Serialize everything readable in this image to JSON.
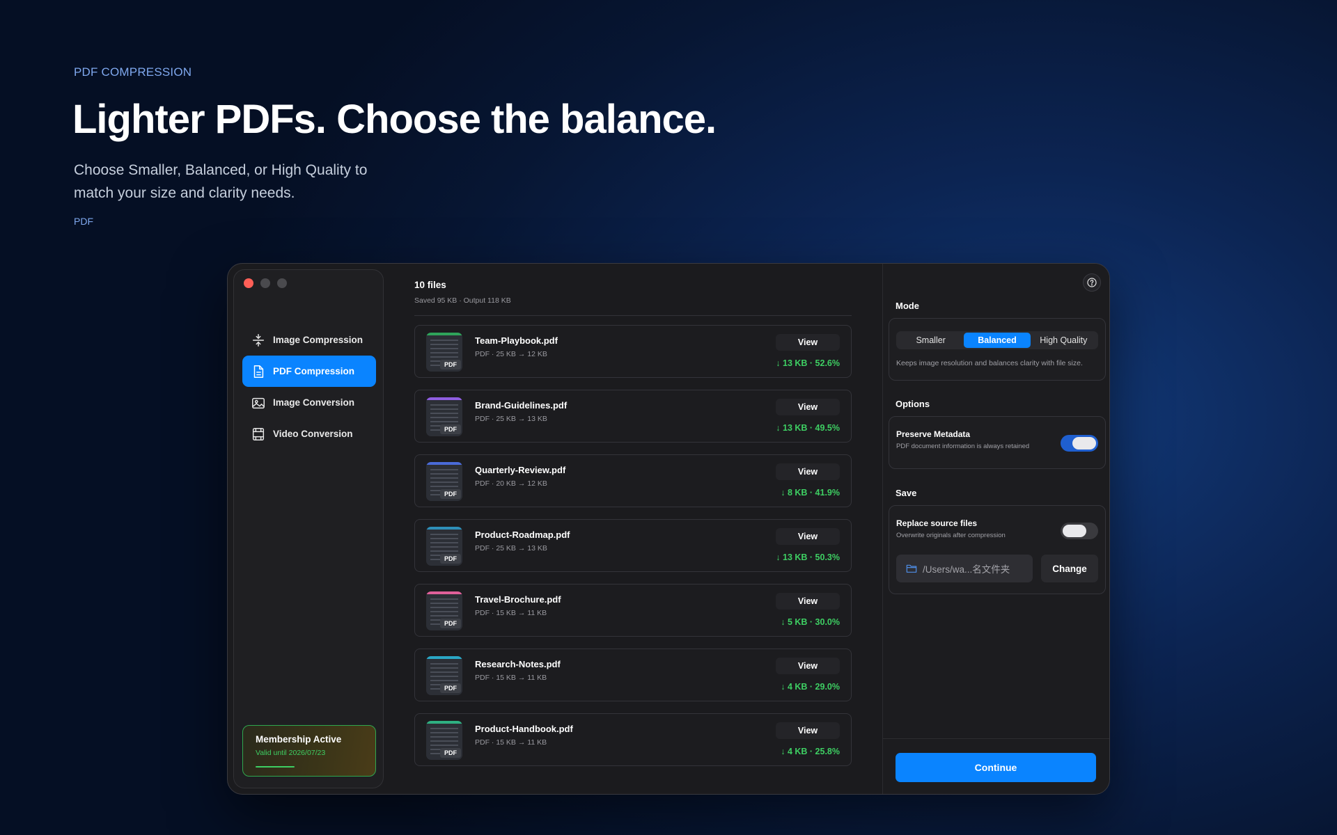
{
  "hero": {
    "eyebrow": "PDF COMPRESSION",
    "title": "Lighter PDFs. Choose the balance.",
    "subtitle": "Choose Smaller, Balanced, or High Quality to match your size and clarity needs.",
    "tag": "PDF"
  },
  "sidebar": {
    "items": [
      {
        "label": "Image Compression",
        "icon": "compress-icon"
      },
      {
        "label": "PDF Compression",
        "icon": "document-icon",
        "active": true
      },
      {
        "label": "Image Conversion",
        "icon": "image-icon"
      },
      {
        "label": "Video Conversion",
        "icon": "film-icon"
      }
    ],
    "membership": {
      "title": "Membership Active",
      "valid": "Valid until 2026/07/23"
    }
  },
  "main": {
    "title": "10 files",
    "subtitle": "Saved 95 KB · Output 118 KB",
    "view_label": "View",
    "files": [
      {
        "name": "Team-Playbook.pdf",
        "meta": "PDF · 25 KB → 12 KB",
        "saved": "↓ 13 KB · 52.6%",
        "color": "#2fa35a"
      },
      {
        "name": "Brand-Guidelines.pdf",
        "meta": "PDF · 25 KB → 13 KB",
        "saved": "↓ 13 KB · 49.5%",
        "color": "#8f5ee0"
      },
      {
        "name": "Quarterly-Review.pdf",
        "meta": "PDF · 20 KB → 12 KB",
        "saved": "↓ 8 KB · 41.9%",
        "color": "#4a6bd8"
      },
      {
        "name": "Product-Roadmap.pdf",
        "meta": "PDF · 25 KB → 13 KB",
        "saved": "↓ 13 KB · 50.3%",
        "color": "#2e8fb8"
      },
      {
        "name": "Travel-Brochure.pdf",
        "meta": "PDF · 15 KB → 11 KB",
        "saved": "↓ 5 KB · 30.0%",
        "color": "#e0609a"
      },
      {
        "name": "Research-Notes.pdf",
        "meta": "PDF · 15 KB → 11 KB",
        "saved": "↓ 4 KB · 29.0%",
        "color": "#2aa6c4"
      },
      {
        "name": "Product-Handbook.pdf",
        "meta": "PDF · 15 KB → 11 KB",
        "saved": "↓ 4 KB · 25.8%",
        "color": "#2fb082"
      }
    ],
    "badge": "PDF"
  },
  "panel": {
    "mode_label": "Mode",
    "modes": [
      "Smaller",
      "Balanced",
      "High Quality"
    ],
    "mode_selected": "Balanced",
    "mode_desc": "Keeps image resolution and balances clarity with file size.",
    "options_label": "Options",
    "metadata_title": "Preserve Metadata",
    "metadata_desc": "PDF document information is always retained",
    "save_label": "Save",
    "replace_title": "Replace source files",
    "replace_desc": "Overwrite originals after compression",
    "path": "/Users/wa...名文件夹",
    "change_label": "Change",
    "continue_label": "Continue"
  },
  "colors": {
    "accent": "#0a84ff",
    "success": "#3ecf63"
  }
}
